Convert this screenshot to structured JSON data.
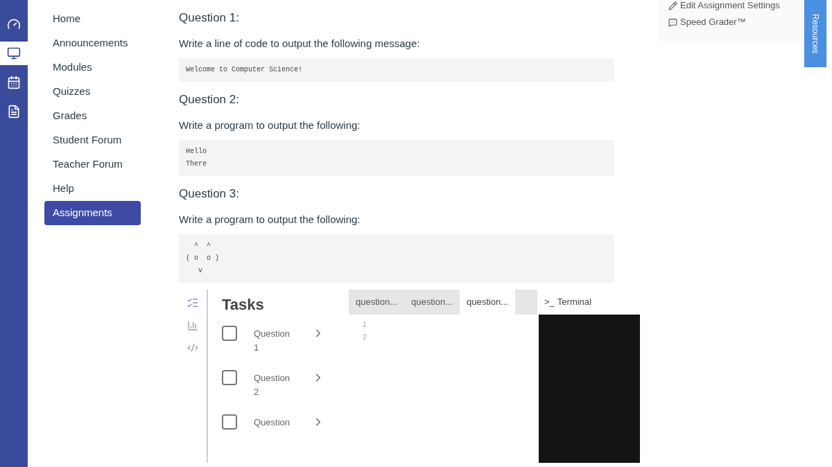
{
  "global_nav": [
    {
      "kind": "dashboard",
      "selected": false
    },
    {
      "kind": "courses",
      "selected": true
    },
    {
      "kind": "calendar",
      "selected": false
    },
    {
      "kind": "inbox",
      "selected": false
    }
  ],
  "course_nav": [
    {
      "label": "Home",
      "selected": false
    },
    {
      "label": "Announcements",
      "selected": false
    },
    {
      "label": "Modules",
      "selected": false
    },
    {
      "label": "Quizzes",
      "selected": false
    },
    {
      "label": "Grades",
      "selected": false
    },
    {
      "label": "Student Forum",
      "selected": false
    },
    {
      "label": "Teacher Forum",
      "selected": false
    },
    {
      "label": "Help",
      "selected": false
    },
    {
      "label": "Assignments",
      "selected": true
    }
  ],
  "questions": [
    {
      "title": "Question 1:",
      "prompt": "Write a line of code to output the following message:",
      "code": "Welcome to Computer Science!"
    },
    {
      "title": "Question 2:",
      "prompt": "Write a program to output the following:",
      "code": "Hello\nThere"
    },
    {
      "title": "Question 3:",
      "prompt": "Write a program to output the following:",
      "code": "  ^  ^\n( o  o )\n   v"
    }
  ],
  "side_actions": [
    {
      "kind": "edit",
      "label": "Edit Assignment Settings"
    },
    {
      "kind": "grader",
      "label": "Speed Grader™"
    }
  ],
  "resources_tab": {
    "label": "Resources"
  },
  "ide": {
    "tasks_title": "Tasks",
    "tasks": [
      {
        "label": "Question 1",
        "checked": false
      },
      {
        "label": "Question 2",
        "checked": false
      },
      {
        "label": "Question",
        "checked": false
      }
    ],
    "editor_tabs": [
      {
        "label": "question...",
        "selected": false
      },
      {
        "label": "question...",
        "selected": false
      },
      {
        "label": "question...",
        "selected": true
      }
    ],
    "line_numbers": [
      "1",
      "2"
    ],
    "terminal_tab": {
      "prompt": ">_",
      "label": "Terminal"
    }
  }
}
